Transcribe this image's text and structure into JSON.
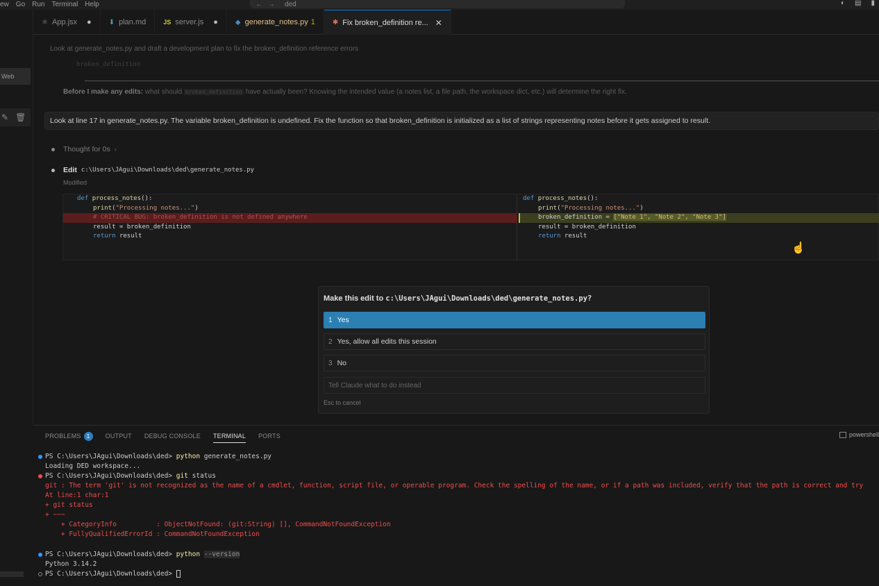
{
  "menubar": {
    "items": [
      "ew",
      "Go",
      "Run",
      "Terminal",
      "Help"
    ],
    "nav_back": "←",
    "nav_forward": "→",
    "workspace": "ded"
  },
  "sidebar": {
    "web_label": "Web"
  },
  "tabs": [
    {
      "icon": "react-icon",
      "label": "App.jsx",
      "modified": true,
      "active": false
    },
    {
      "icon": "markdown-icon",
      "label": "plan.md",
      "modified": false,
      "active": false
    },
    {
      "icon": "javascript-icon",
      "label": "server.js",
      "icon_text": "JS",
      "modified": true,
      "active": false
    },
    {
      "icon": "python-icon",
      "label": "generate_notes.py",
      "count": "1",
      "modified": false,
      "active": false
    },
    {
      "icon": "claude-icon",
      "label": "Fix broken_definition re...",
      "active": true
    }
  ],
  "chat": {
    "prev_message": "Look at generate_notes.py and draft a development plan to fix the broken_definition reference errors",
    "prev_code": "broken_definition",
    "prev_question_bold": "Before I make any edits:",
    "prev_question_pre": "what should",
    "prev_question_code": "broken_definition",
    "prev_question_post": "have actually been? Knowing the intended value (a notes list, a file path, the workspace dict, etc.) will determine the right fix.",
    "user_message": "Look at line 17 in generate_notes.py. The variable broken_definition is undefined. Fix the function so that broken_definition is initialized as a list of strings representing notes before it gets assigned to result.",
    "thought": "Thought for 0s",
    "edit_label": "Edit",
    "edit_path": "c:\\Users\\JAgui\\Downloads\\ded\\generate_notes.py",
    "edit_status": "Modified"
  },
  "diff": {
    "left": {
      "def_kw": "def",
      "fn_name": "process_notes",
      "fn_tail": "():",
      "print_fn": "print",
      "print_str": "\"Processing notes...\"",
      "removed": "# CRITICAL BUG: broken_definition is not defined anywhere",
      "assign": "result = broken_definition",
      "return_kw": "return",
      "return_val": "result"
    },
    "right": {
      "def_kw": "def",
      "fn_name": "process_notes",
      "fn_tail": "():",
      "print_fn": "print",
      "print_str": "\"Processing notes...\"",
      "added_lhs": "broken_definition = ",
      "added_rhs": "[\"Note 1\", \"Note 2\", \"Note 3\"]",
      "assign": "result = broken_definition",
      "return_kw": "return",
      "return_val": "result"
    }
  },
  "permission": {
    "title_prefix": "Make this edit to",
    "title_path": "c:\\Users\\JAgui\\Downloads\\ded\\generate_notes.py?",
    "options": [
      {
        "num": "1",
        "label": "Yes"
      },
      {
        "num": "2",
        "label": "Yes, allow all edits this session"
      },
      {
        "num": "3",
        "label": "No"
      }
    ],
    "input_placeholder": "Tell Claude what to do instead",
    "esc_hint": "Esc to cancel"
  },
  "panel": {
    "tabs": [
      {
        "label": "PROBLEMS",
        "badge": "1"
      },
      {
        "label": "OUTPUT"
      },
      {
        "label": "DEBUG CONSOLE"
      },
      {
        "label": "TERMINAL",
        "active": true
      },
      {
        "label": "PORTS"
      }
    ],
    "shell": "powershell"
  },
  "terminal": {
    "prompt": "PS C:\\Users\\JAgui\\Downloads\\ded> ",
    "l1_cmd": "python",
    "l1_arg": " generate_notes.py",
    "l2": "Loading DED workspace...",
    "l3_cmd": "git",
    "l3_arg": " status",
    "err1": "git : The term 'git' is not recognized as the name of a cmdlet, function, script file, or operable program. Check the spelling of the name, or if a path was included, verify that the path is correct and try",
    "err2": "At line:1 char:1",
    "err3": "+ git status",
    "err4": "+ ~~~",
    "err5": "    + CategoryInfo          : ObjectNotFound: (git:String) [], CommandNotFoundException",
    "err6": "    + FullyQualifiedErrorId : CommandNotFoundException",
    "l9_cmd": "python",
    "l9_flag": "--version",
    "l10": "Python 3.14.2"
  },
  "colors": {
    "accent": "#2c7fb3",
    "error": "#f14c4c",
    "diff_removed": "#5a1d1d",
    "diff_added": "#3b3f20"
  }
}
